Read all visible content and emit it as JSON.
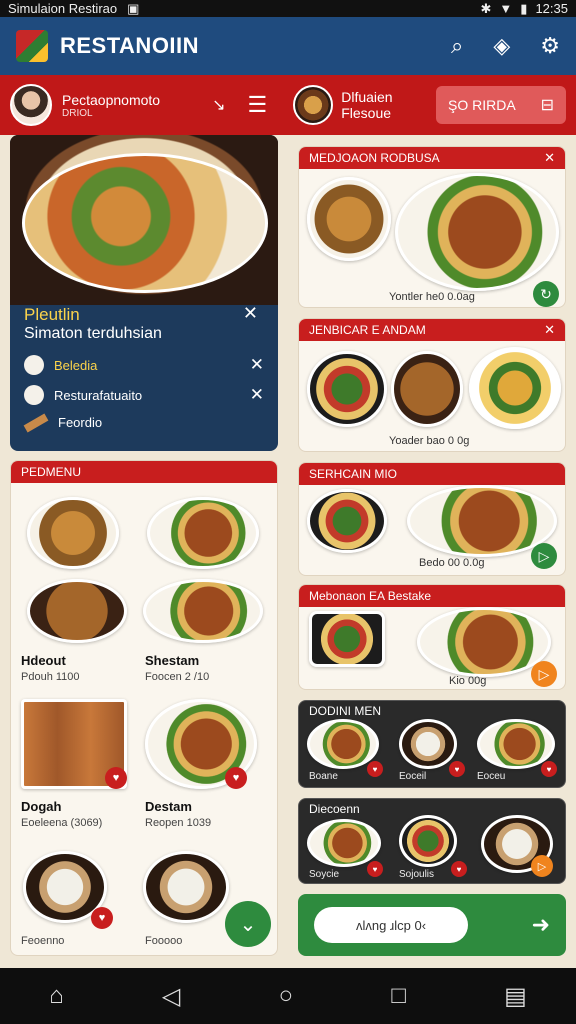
{
  "status": {
    "left": "Simulaion Restirao",
    "time": "12:35"
  },
  "appbar": {
    "title": "RESTANOIIN",
    "icons": [
      "search-icon",
      "share-icon",
      "settings-icon"
    ]
  },
  "profile": {
    "name": "Pectaopnomoto",
    "sub": "DRIOL"
  },
  "dish": {
    "line1": "Dlfuaien",
    "line2": "Flesoue"
  },
  "order_button": {
    "label": "ŞO RIRDA"
  },
  "hero": {
    "title": "Pleutlin",
    "subtitle": "Simaton terduhsian",
    "rows": [
      {
        "label": "Beledia"
      },
      {
        "label": "Resturafatuaito"
      },
      {
        "label": "Feordio"
      }
    ]
  },
  "menu": {
    "header": "PEDMENU",
    "items": [
      {
        "name": "Hdeout",
        "price": "Pdouh 1100"
      },
      {
        "name": "Shestam",
        "price": "Foocen 2 /10"
      },
      {
        "name": "Dogah",
        "price": "Eoeleena (3069)"
      },
      {
        "name": "Destam",
        "price": "Reopen 1039"
      },
      {
        "name": "",
        "price": "Feoenno"
      },
      {
        "name": "",
        "price": "Fooooo"
      }
    ]
  },
  "cards": [
    {
      "header": "MEDJOAON RODBUSA",
      "footer": "Yontler he0 0.0ag"
    },
    {
      "header": "JENBICAR E ANDAM",
      "footer": "Yoader bao 0 0g"
    },
    {
      "header": "SERHCAIN MIO",
      "footer": "Bedo 00 0.0g"
    },
    {
      "header": "Mebonaon EA Bestake",
      "footer": "Kio 00g"
    }
  ],
  "dark_cards": [
    {
      "header": "DODINI MEN",
      "items": [
        "Boane",
        "Eoceil",
        "Eoceu"
      ]
    },
    {
      "header": "Diecoenn",
      "items": [
        "Soycie",
        "Sojoulis",
        ""
      ]
    }
  ],
  "cta": {
    "pill": "ʌlʌng ɹlcp 0‹"
  },
  "navbar": {
    "icons": [
      "home-icon",
      "back-icon",
      "home-circle-icon",
      "recents-icon",
      "apps-icon"
    ]
  }
}
